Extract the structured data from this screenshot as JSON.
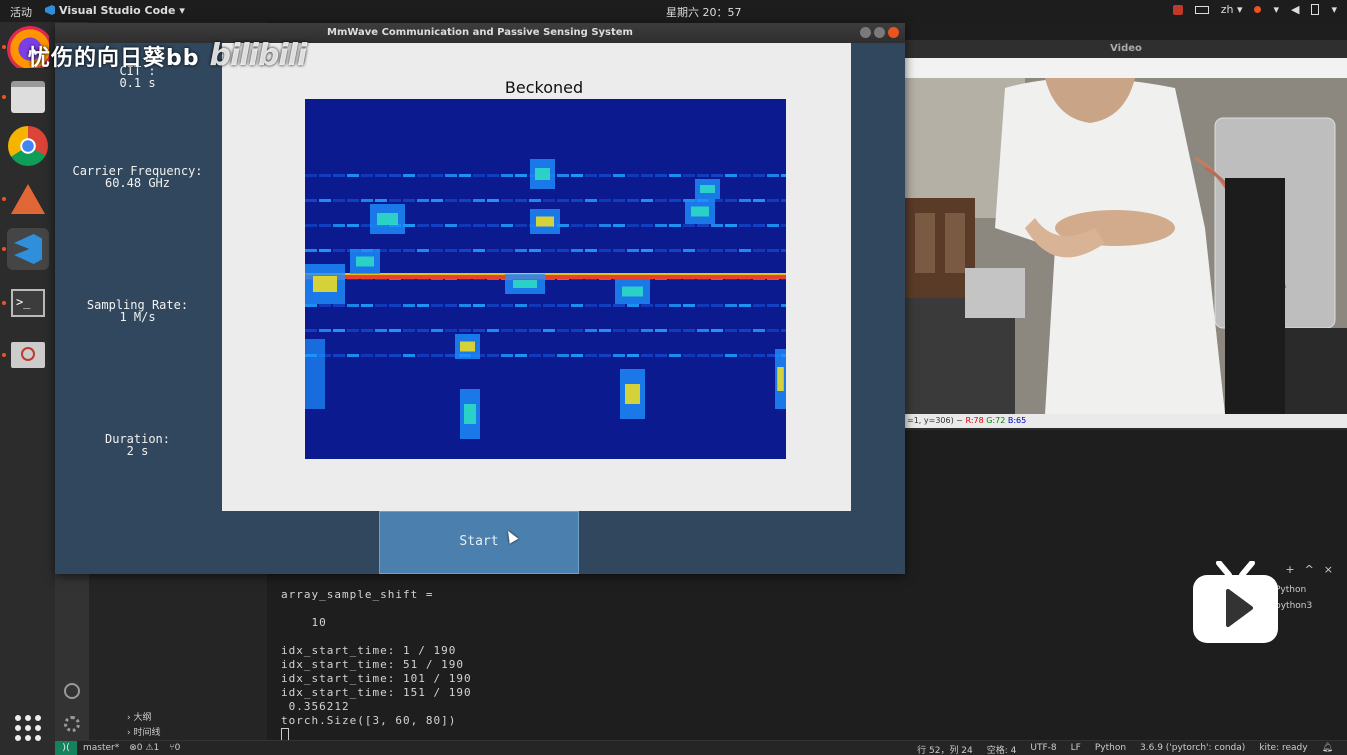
{
  "topbar": {
    "activities": "活动",
    "app_menu": "Visual Studio Code ▾",
    "clock": "星期六 20：57",
    "input_method": "zh ▾"
  },
  "watermark": {
    "user": "忧伤的向日葵bb",
    "logo": "bilibili"
  },
  "main_window": {
    "title": "MmWave Communication and Passive Sensing System",
    "params": [
      {
        "label": "CIT :",
        "value": "0.1 s"
      },
      {
        "label": "Carrier Frequency:",
        "value": "60.48 GHz"
      },
      {
        "label": "Sampling Rate:",
        "value": "1 M/s"
      },
      {
        "label": "Duration:",
        "value": "2 s"
      }
    ],
    "plot_title": "Beckoned",
    "start_label": "Start"
  },
  "video_window": {
    "title": "Video",
    "status_prefix": "=1, y=306) ~ ",
    "r": "R:78",
    "g": "G:72",
    "b": "B:65"
  },
  "terminal": {
    "lines": [
      "array_sample_shift =",
      "",
      "    10",
      "",
      "idx_start_time: 1 / 190",
      "idx_start_time: 51 / 190",
      "idx_start_time: 101 / 190",
      "idx_start_time: 151 / 190",
      " 0.356212",
      "torch.Size([3, 60, 80])"
    ],
    "list": [
      "Python",
      "python3"
    ]
  },
  "sidebar": {
    "outline": "大纲",
    "timeline": "时间线"
  },
  "statusbar": {
    "branch": "master*",
    "errors": "⊗0 ⚠1",
    "ports": "⑂0",
    "position": "行 52，列 24",
    "spaces": "空格: 4",
    "encoding": "UTF-8",
    "eol": "LF",
    "language": "Python",
    "interpreter": "3.6.9 ('pytorch': conda)",
    "kite": "kite: ready"
  },
  "colors": {
    "spectro_bg": "#0c1a8f",
    "window_bg": "#30475d",
    "start_button": "#4a7fae",
    "accent_orange": "#e95420"
  }
}
